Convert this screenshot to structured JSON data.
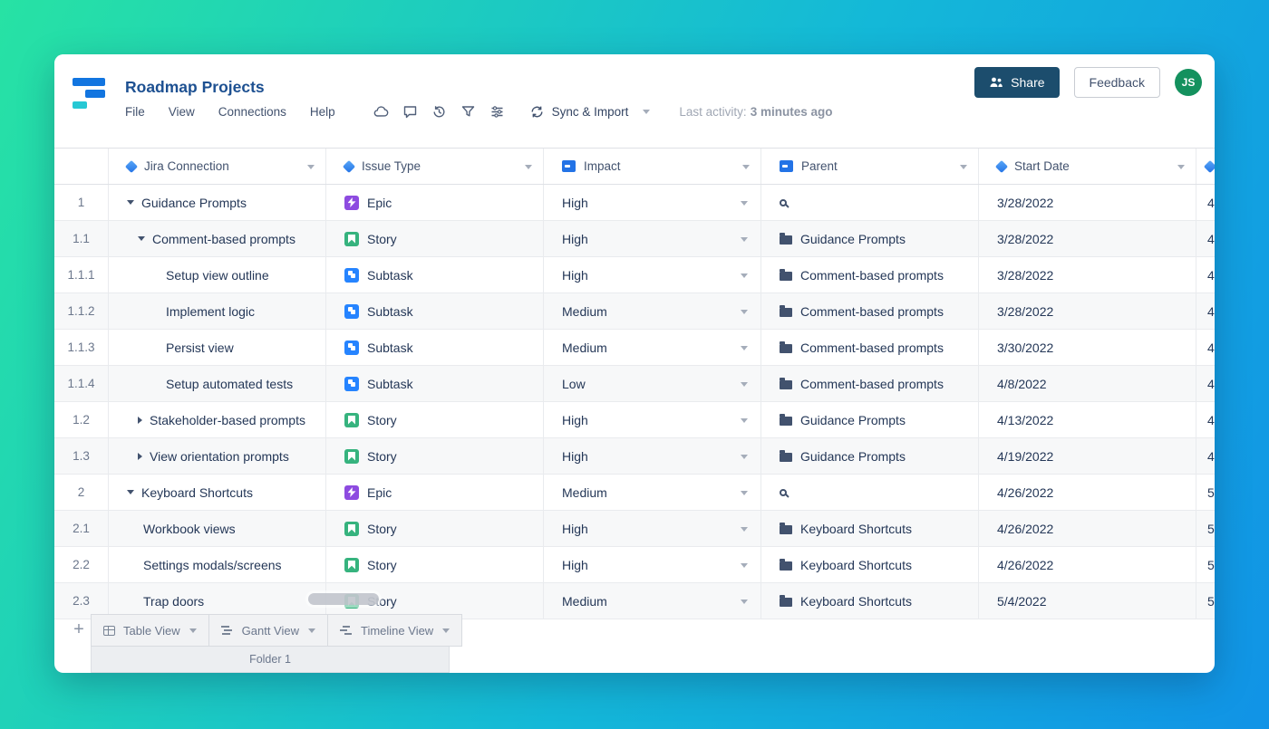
{
  "header": {
    "title": "Roadmap Projects",
    "menu": [
      "File",
      "View",
      "Connections",
      "Help"
    ],
    "sync_label": "Sync & Import",
    "last_activity_label": "Last activity:",
    "last_activity_value": "3 minutes ago",
    "share_label": "Share",
    "feedback_label": "Feedback",
    "avatar_initials": "JS"
  },
  "table": {
    "columns": [
      {
        "label": "Jira Connection",
        "icon": "diamond"
      },
      {
        "label": "Issue Type",
        "icon": "diamond"
      },
      {
        "label": "Impact",
        "icon": "field"
      },
      {
        "label": "Parent",
        "icon": "field"
      },
      {
        "label": "Start Date",
        "icon": "diamond"
      }
    ],
    "rows": [
      {
        "num": "1",
        "name": "Guidance Prompts",
        "caret": "down",
        "indent": 1,
        "type": "Epic",
        "impact": "High",
        "parent": null,
        "parent_search": true,
        "start": "3/28/2022",
        "clip": "4"
      },
      {
        "num": "1.1",
        "name": "Comment-based prompts",
        "caret": "down",
        "indent": 2,
        "type": "Story",
        "impact": "High",
        "parent": "Guidance Prompts",
        "parent_search": false,
        "start": "3/28/2022",
        "clip": "4"
      },
      {
        "num": "1.1.1",
        "name": "Setup view outline",
        "caret": null,
        "indent": 3,
        "type": "Subtask",
        "impact": "High",
        "parent": "Comment-based prompts",
        "parent_search": false,
        "start": "3/28/2022",
        "clip": "4"
      },
      {
        "num": "1.1.2",
        "name": "Implement logic",
        "caret": null,
        "indent": 3,
        "type": "Subtask",
        "impact": "Medium",
        "parent": "Comment-based prompts",
        "parent_search": false,
        "start": "3/28/2022",
        "clip": "4"
      },
      {
        "num": "1.1.3",
        "name": "Persist view",
        "caret": null,
        "indent": 3,
        "type": "Subtask",
        "impact": "Medium",
        "parent": "Comment-based prompts",
        "parent_search": false,
        "start": "3/30/2022",
        "clip": "4"
      },
      {
        "num": "1.1.4",
        "name": "Setup automated tests",
        "caret": null,
        "indent": 3,
        "type": "Subtask",
        "impact": "Low",
        "parent": "Comment-based prompts",
        "parent_search": false,
        "start": "4/8/2022",
        "clip": "4"
      },
      {
        "num": "1.2",
        "name": "Stakeholder-based prompts",
        "caret": "right",
        "indent": 2,
        "type": "Story",
        "impact": "High",
        "parent": "Guidance Prompts",
        "parent_search": false,
        "start": "4/13/2022",
        "clip": "4"
      },
      {
        "num": "1.3",
        "name": "View orientation prompts",
        "caret": "right",
        "indent": 2,
        "type": "Story",
        "impact": "High",
        "parent": "Guidance Prompts",
        "parent_search": false,
        "start": "4/19/2022",
        "clip": "4"
      },
      {
        "num": "2",
        "name": "Keyboard Shortcuts",
        "caret": "down",
        "indent": 1,
        "type": "Epic",
        "impact": "Medium",
        "parent": null,
        "parent_search": true,
        "start": "4/26/2022",
        "clip": "5"
      },
      {
        "num": "2.1",
        "name": "Workbook views",
        "caret": null,
        "indent": 1,
        "type": "Story",
        "impact": "High",
        "parent": "Keyboard Shortcuts",
        "parent_search": false,
        "start": "4/26/2022",
        "clip": "5"
      },
      {
        "num": "2.2",
        "name": "Settings modals/screens",
        "caret": null,
        "indent": 1,
        "type": "Story",
        "impact": "High",
        "parent": "Keyboard Shortcuts",
        "parent_search": false,
        "start": "4/26/2022",
        "clip": "5"
      },
      {
        "num": "2.3",
        "name": "Trap doors",
        "caret": null,
        "indent": 1,
        "type": "Story",
        "impact": "Medium",
        "parent": "Keyboard Shortcuts",
        "parent_search": false,
        "start": "5/4/2022",
        "clip": "5"
      }
    ]
  },
  "issue_types": {
    "Epic": {
      "color": "#8d4be0"
    },
    "Story": {
      "color": "#36b37e"
    },
    "Subtask": {
      "color": "#2684ff"
    }
  },
  "footer": {
    "add_label": "+",
    "tabs": [
      {
        "label": "Table View",
        "icon": "table-icon"
      },
      {
        "label": "Gantt View",
        "icon": "gantt-icon"
      },
      {
        "label": "Timeline View",
        "icon": "timeline-icon"
      }
    ],
    "folder_label": "Folder 1"
  },
  "colors": {
    "accent_blue": "#2373e6",
    "title_blue": "#1d5091",
    "share_bg": "#1c4d6d",
    "avatar_green": "#14915e",
    "logo_blue": "#1275e0",
    "logo_teal": "#27c8d4",
    "bg_gradient_start": "#27e2a4",
    "bg_gradient_mid": "#14b8d8",
    "bg_gradient_end": "#1193e6"
  }
}
